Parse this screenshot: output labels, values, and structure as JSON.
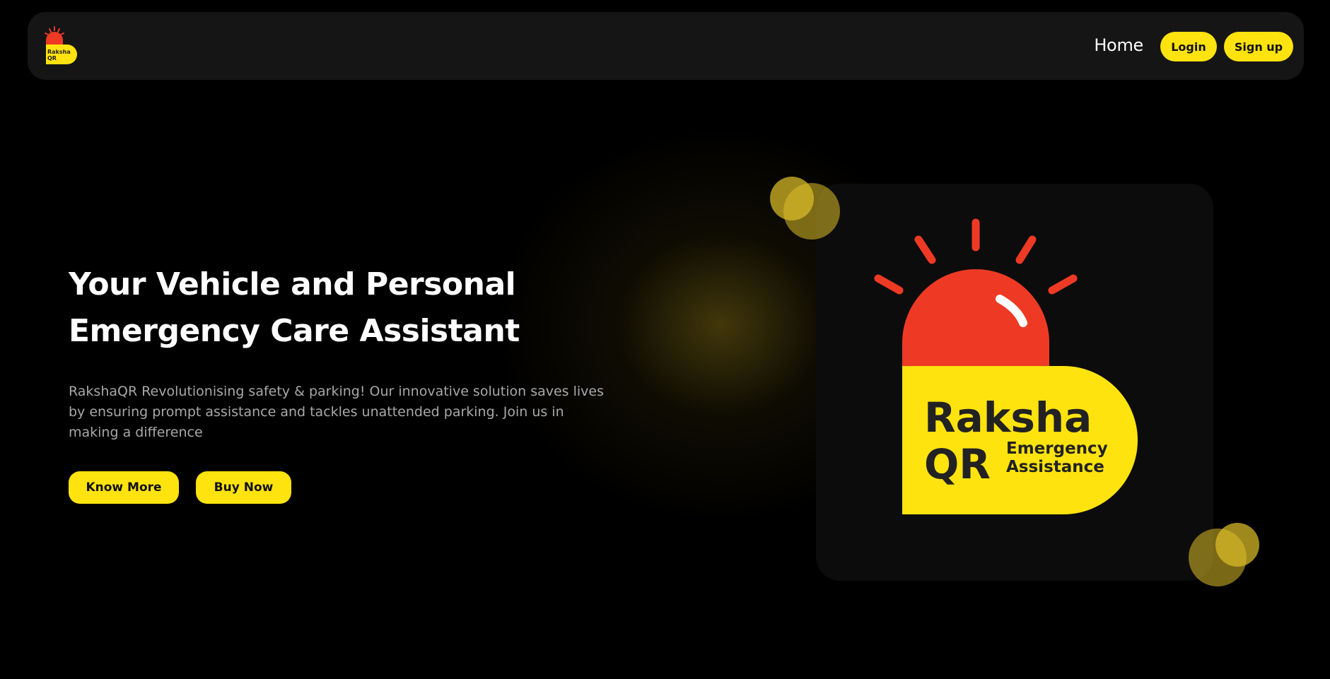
{
  "navbar": {
    "logo_text_line1": "Raksha",
    "logo_text_line2": "QR",
    "home_label": "Home",
    "login_label": "Login",
    "signup_label": "Sign up"
  },
  "hero": {
    "title_line1": "Your Vehicle and Personal",
    "title_line2": "Emergency Care Assistant",
    "description": "RakshaQR Revolutionising safety & parking! Our innovative solution saves lives by ensuring prompt assistance and tackles unattended parking. Join us in making a difference",
    "know_more_label": "Know More",
    "buy_now_label": "Buy Now"
  },
  "card_logo": {
    "brand_line1": "Raksha",
    "brand_line2": "QR",
    "tagline_line1": "Emergency",
    "tagline_line2": "Assistance"
  },
  "colors": {
    "accent_yellow": "#ffe30e",
    "siren_red": "#ee3a24",
    "background": "#000000",
    "navbar_bg": "#151515",
    "card_bg": "#0c0c0c"
  }
}
